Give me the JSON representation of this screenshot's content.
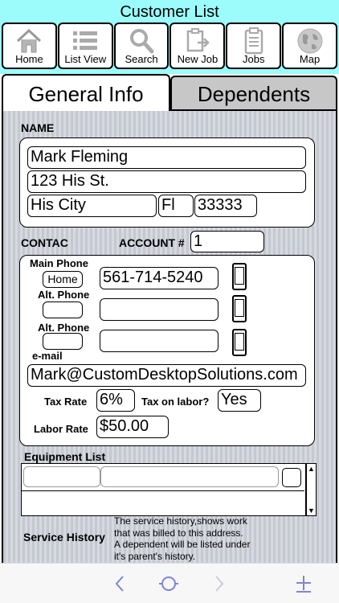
{
  "header": {
    "title": "Customer List",
    "nav": [
      {
        "label": "Home",
        "icon": "home-icon"
      },
      {
        "label": "List View",
        "icon": "list-icon"
      },
      {
        "label": "Search",
        "icon": "search-icon"
      },
      {
        "label": "New Job",
        "icon": "new-job-icon"
      },
      {
        "label": "Jobs",
        "icon": "clipboard-icon"
      },
      {
        "label": "Map",
        "icon": "globe-icon"
      }
    ],
    "bg_color": "#9cfcfc"
  },
  "tabs": {
    "active": "General Info",
    "inactive": "Dependents"
  },
  "name_section": {
    "label": "NAME",
    "name": "Mark Fleming",
    "street": "123 His St.",
    "city": "His City",
    "state": "Fl",
    "zip": "33333"
  },
  "contact_section": {
    "label": "CONTAC",
    "account_label": "ACCOUNT #",
    "account_value": "1",
    "main_phone_label": "Main Phone",
    "main_phone_type": "Home",
    "main_phone_value": "561-714-5240",
    "alt_phone1_label": "Alt. Phone",
    "alt_phone1_type": "",
    "alt_phone1_value": "",
    "alt_phone2_label": "Alt. Phone",
    "alt_phone2_type": "",
    "alt_phone2_value": "",
    "email_label": "e-mail",
    "email_value": "Mark@CustomDesktopSolutions.com",
    "tax_rate_label": "Tax Rate",
    "tax_rate_value": "6%",
    "tax_labor_label": "Tax on labor?",
    "tax_labor_value": "Yes",
    "labor_rate_label": "Labor Rate",
    "labor_rate_value": "$50.00"
  },
  "equipment": {
    "label": "Equipment List"
  },
  "service_history": {
    "label": "Service History",
    "lines": [
      "The service history,shows work",
      "that was billed to this address.",
      "A dependent will be listed under",
      "it's parent's history."
    ]
  },
  "toolbar": {
    "back_icon": "chevron-left-icon",
    "circle_icon": "circle-icon",
    "forward_icon": "chevron-right-icon",
    "add_icon": "plus-icon"
  }
}
